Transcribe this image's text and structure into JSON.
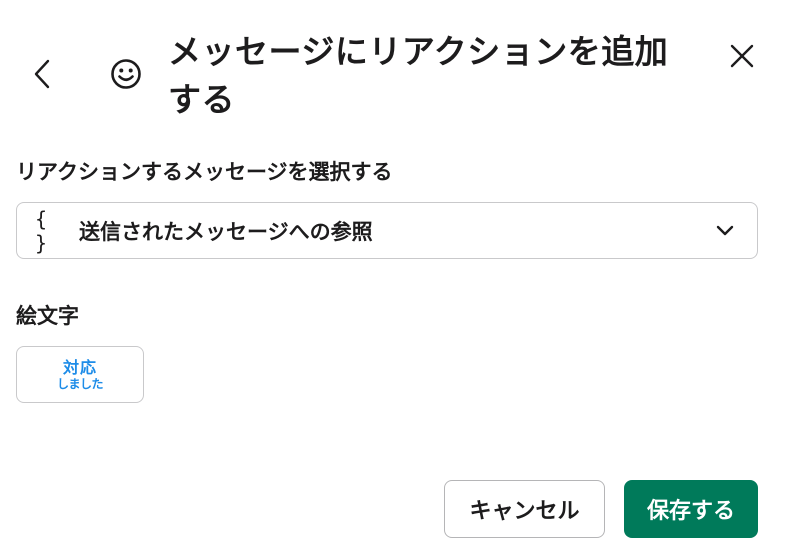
{
  "dialog": {
    "title": "メッセージにリアクションを追加する",
    "title_icon": "smiley-face-icon",
    "back_icon": "chevron-left-icon",
    "close_icon": "close-x-icon"
  },
  "message_field": {
    "label": "リアクションするメッセージを選択する",
    "value_icon": "curly-braces-icon",
    "value_icon_text": "{ }",
    "value": "送信されたメッセージへの参照",
    "dropdown_icon": "chevron-down-icon"
  },
  "emoji_field": {
    "label": "絵文字",
    "selected_emoji": {
      "line1": "対応",
      "line2": "しました",
      "color": "#1d8ce8"
    }
  },
  "footer": {
    "cancel_label": "キャンセル",
    "save_label": "保存する",
    "save_color": "#007a5a"
  }
}
